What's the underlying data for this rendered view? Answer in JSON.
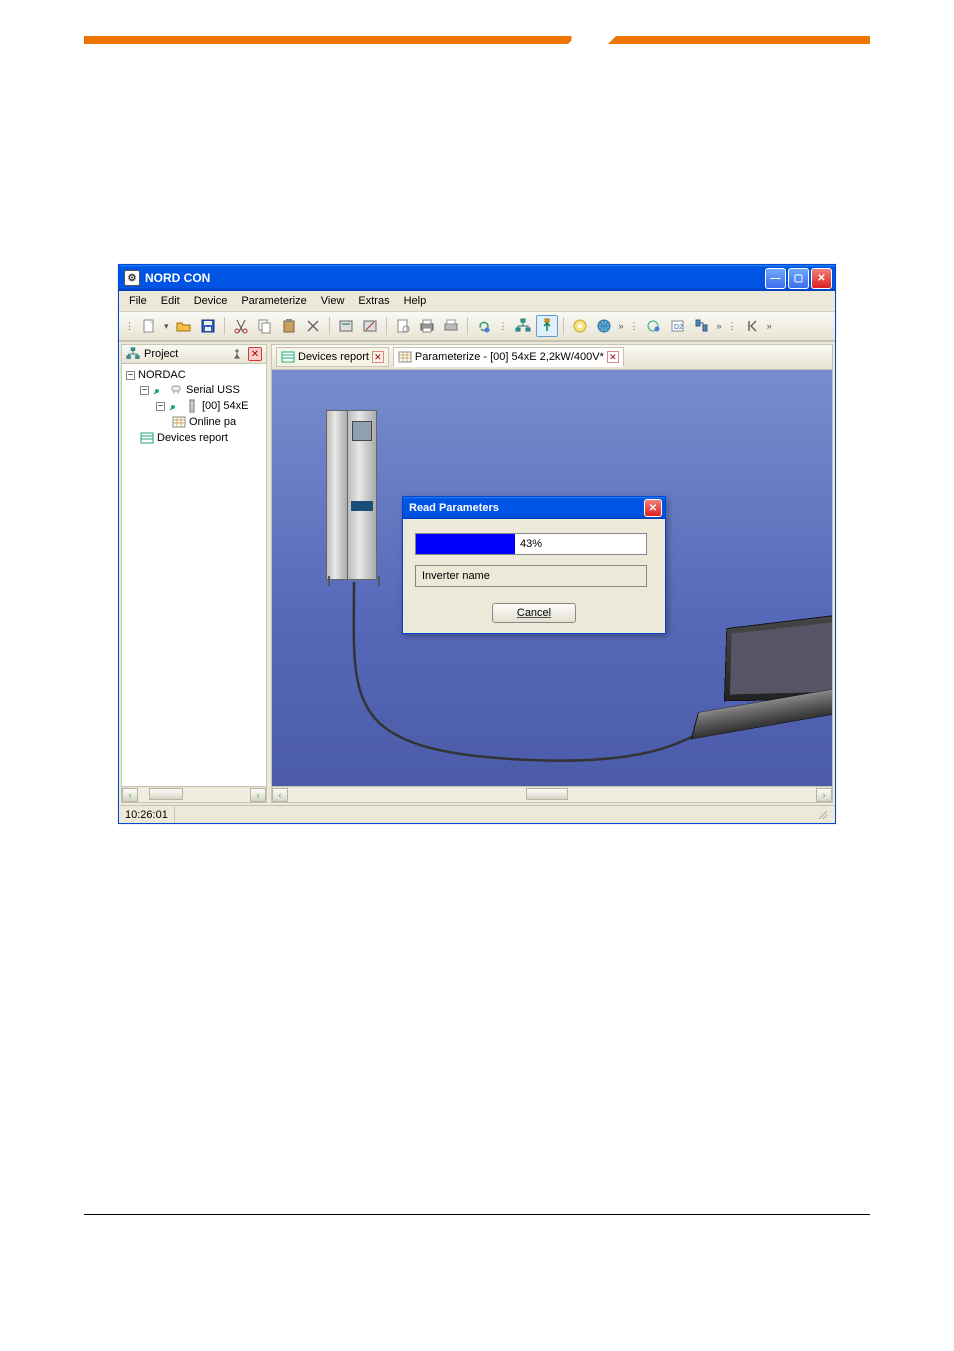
{
  "app": {
    "title": "NORD CON",
    "icon_glyph": "⚙"
  },
  "menu": {
    "file": "File",
    "edit": "Edit",
    "device": "Device",
    "parameterize": "Parameterize",
    "view": "View",
    "extras": "Extras",
    "help": "Help"
  },
  "toolbar": {
    "new": "new",
    "open": "open",
    "save": "save",
    "cut": "cut",
    "copy": "copy",
    "paste": "paste",
    "delete": "delete",
    "device1": "device-overview",
    "device2": "device-remove",
    "preview": "print-preview",
    "print": "print",
    "print2": "print-setup",
    "refresh": "refresh",
    "struct": "structure",
    "upload": "upload",
    "clock": "settings",
    "globe": "online",
    "more1": "»",
    "ext1": "ext1",
    "ext2": "ext2",
    "ext3": "ext3",
    "more2": "»",
    "nav": "nav-first",
    "more3": "»"
  },
  "sidebar": {
    "title": "Project",
    "tree": {
      "root": "NORDAC",
      "node1": "Serial USS",
      "node2": "[00] 54xE",
      "node3": "Online pa",
      "node4": "Devices report"
    }
  },
  "tabs": {
    "t1": "Devices report",
    "t2": "Parameterize - [00] 54xE 2,2kW/400V*"
  },
  "dialog": {
    "title": "Read Parameters",
    "progress_value": 43,
    "progress_label": "43%",
    "field_label": "Inverter name",
    "cancel": "Cancel"
  },
  "status": {
    "time": "10:26:01"
  }
}
